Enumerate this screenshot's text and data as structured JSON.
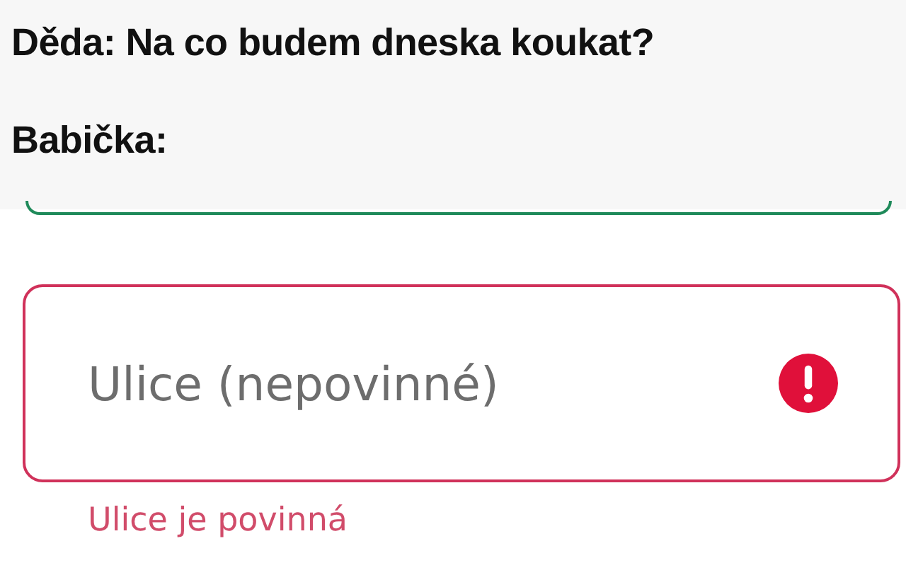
{
  "caption": [
    {
      "speaker": "Děda:",
      "line": "Na co budem dneska koukat?"
    },
    {
      "speaker": "Babička:"
    }
  ],
  "previous_field": {
    "valid": true
  },
  "field": {
    "placeholder": "Ulice (nepovinné)",
    "error": true,
    "error_message": "Ulice je povinná"
  }
}
